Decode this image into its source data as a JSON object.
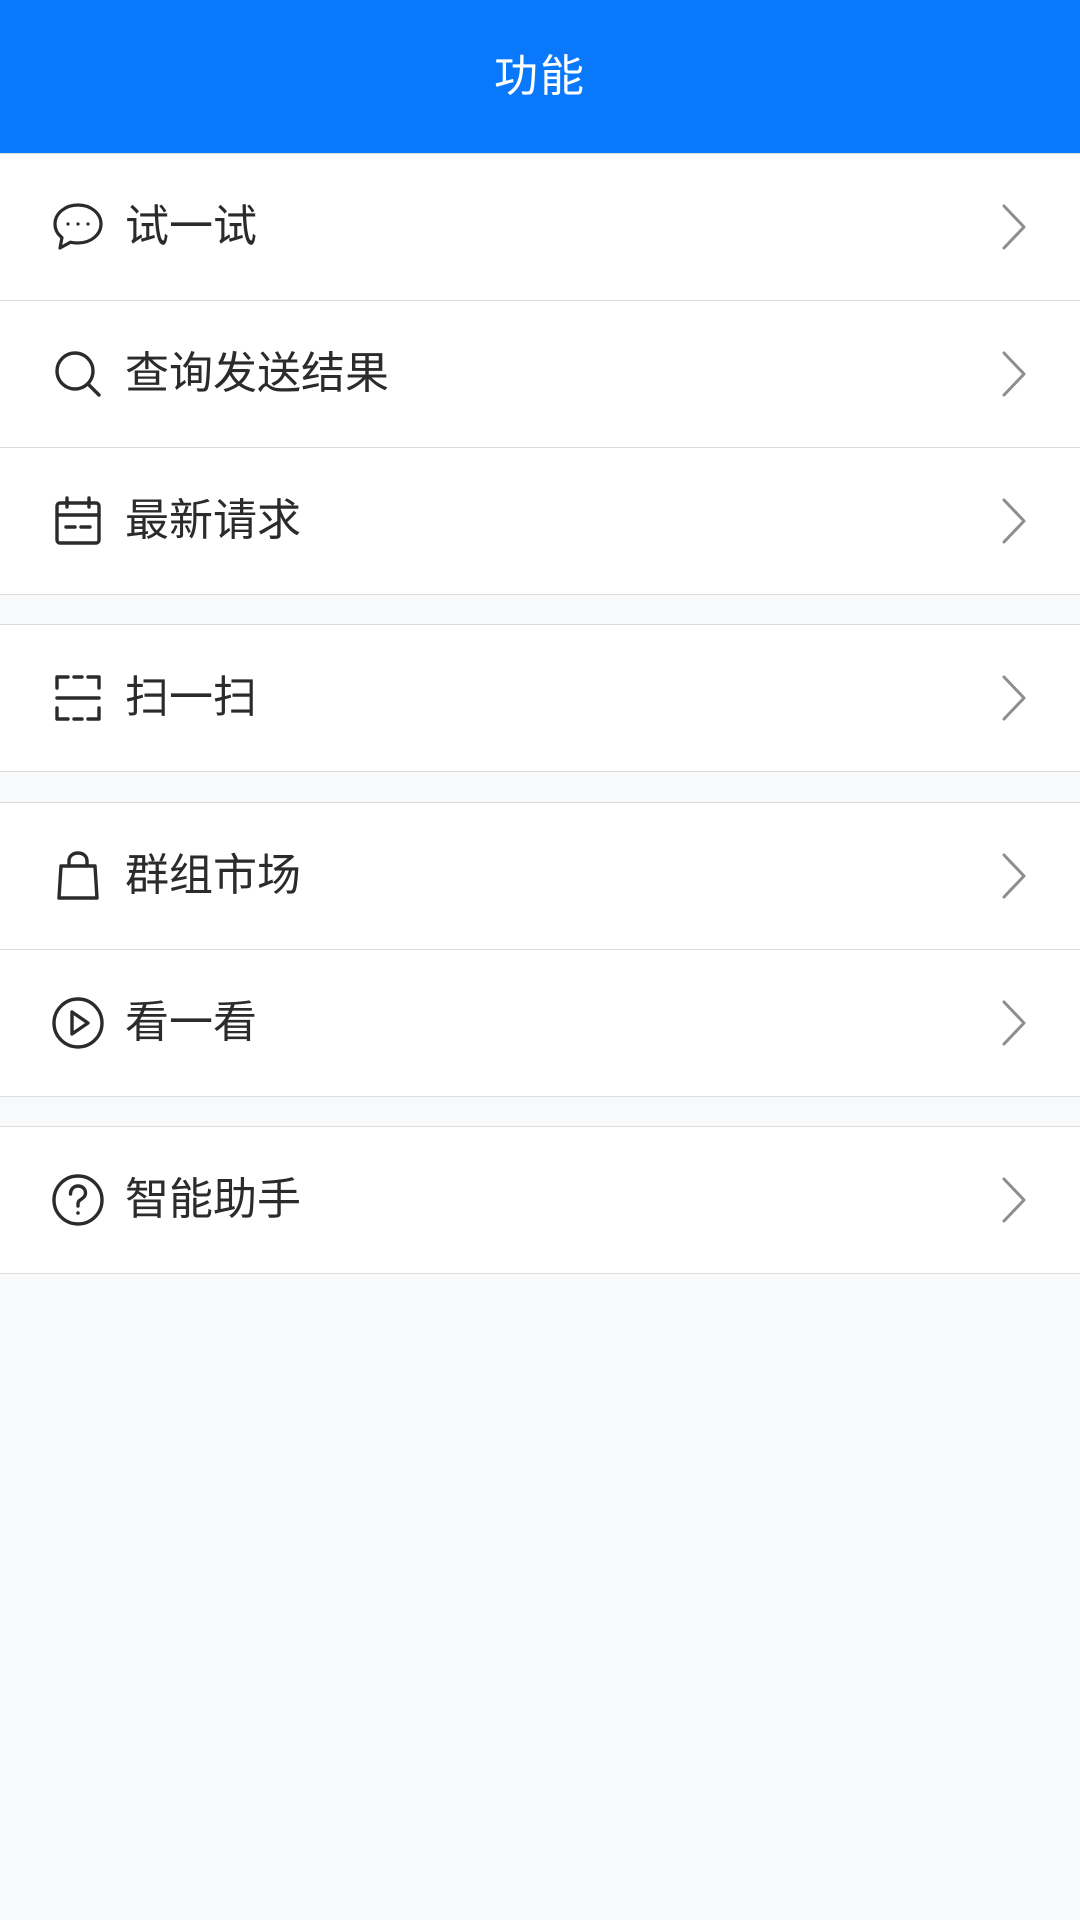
{
  "header": {
    "title": "功能"
  },
  "groups": [
    {
      "items": [
        {
          "label": "试一试",
          "icon": "chat-bubble-icon"
        },
        {
          "label": "查询发送结果",
          "icon": "search-icon"
        },
        {
          "label": "最新请求",
          "icon": "calendar-icon"
        }
      ]
    },
    {
      "items": [
        {
          "label": "扫一扫",
          "icon": "scan-icon"
        }
      ]
    },
    {
      "items": [
        {
          "label": "群组市场",
          "icon": "shopping-bag-icon"
        },
        {
          "label": "看一看",
          "icon": "play-circle-icon"
        }
      ]
    },
    {
      "items": [
        {
          "label": "智能助手",
          "icon": "question-circle-icon"
        }
      ]
    }
  ],
  "colors": {
    "header_bg": "#0a78fa",
    "page_bg": "#f8f9fb",
    "text": "#2b2b2b",
    "chevron": "#8e8e8e"
  }
}
